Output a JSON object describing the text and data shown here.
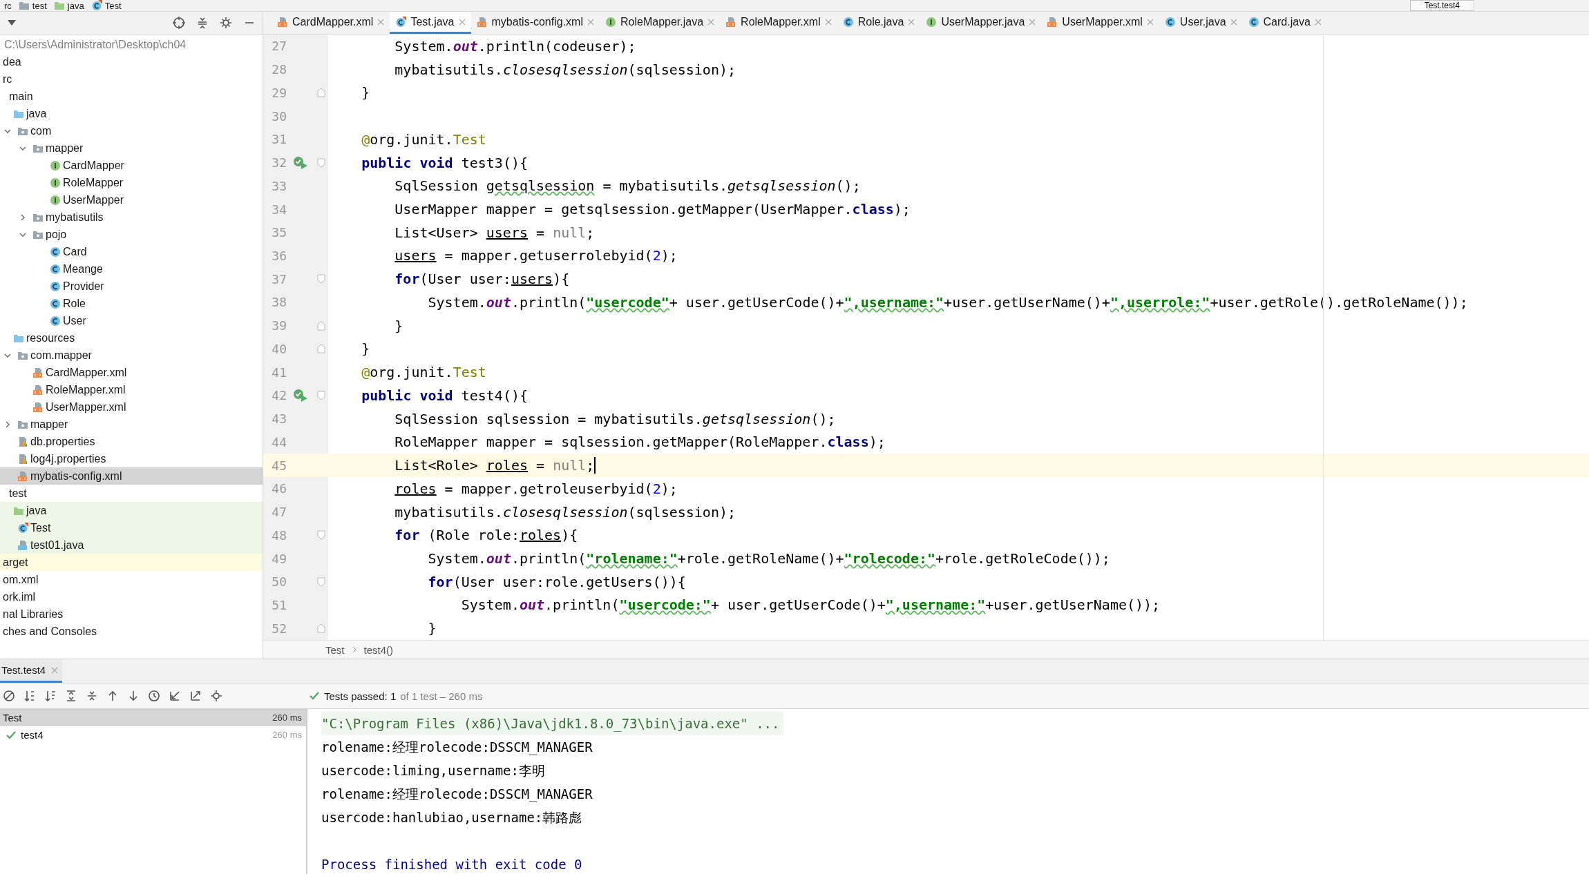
{
  "nav_bar": {
    "crumbs": [
      {
        "label": "rc",
        "kind": "none"
      },
      {
        "label": "test",
        "kind": "folder"
      },
      {
        "label": "java",
        "kind": "test-folder"
      },
      {
        "label": "Test",
        "kind": "test-class"
      }
    ],
    "run_config": "Test.test4"
  },
  "project": {
    "path": "C:\\Users\\Administrator\\Desktop\\ch04",
    "tree": [
      {
        "label": "dea",
        "selected": false
      },
      {
        "label": "rc",
        "selected": false,
        "children": [
          {
            "label": "main",
            "selected": false,
            "children": [
              {
                "label": "java",
                "kind": "source-folder",
                "selected": false,
                "children": [
                  {
                    "label": "com",
                    "kind": "package",
                    "expanded": true,
                    "selected": false,
                    "children": [
                      {
                        "label": "mapper",
                        "kind": "package",
                        "expanded": true,
                        "selected": false,
                        "children": [
                          {
                            "label": "CardMapper",
                            "kind": "interface",
                            "selected": false
                          },
                          {
                            "label": "RoleMapper",
                            "kind": "interface",
                            "selected": false
                          },
                          {
                            "label": "UserMapper",
                            "kind": "interface",
                            "selected": false
                          }
                        ]
                      },
                      {
                        "label": "mybatisutils",
                        "kind": "package",
                        "expanded": false,
                        "selected": false
                      },
                      {
                        "label": "pojo",
                        "kind": "package",
                        "expanded": true,
                        "selected": false,
                        "children": [
                          {
                            "label": "Card",
                            "kind": "class",
                            "selected": false
                          },
                          {
                            "label": "Meange",
                            "kind": "class",
                            "selected": false
                          },
                          {
                            "label": "Provider",
                            "kind": "class",
                            "selected": false
                          },
                          {
                            "label": "Role",
                            "kind": "class",
                            "selected": false
                          },
                          {
                            "label": "User",
                            "kind": "class",
                            "selected": false
                          }
                        ]
                      }
                    ]
                  }
                ]
              },
              {
                "label": "resources",
                "kind": "resource-folder",
                "selected": false,
                "children": [
                  {
                    "label": "com.mapper",
                    "kind": "package",
                    "expanded": true,
                    "selected": false,
                    "children": [
                      {
                        "label": "CardMapper.xml",
                        "kind": "xml",
                        "selected": false
                      },
                      {
                        "label": "RoleMapper.xml",
                        "kind": "xml",
                        "selected": false
                      },
                      {
                        "label": "UserMapper.xml",
                        "kind": "xml",
                        "selected": false
                      }
                    ]
                  },
                  {
                    "label": "mapper",
                    "kind": "package",
                    "expanded": false,
                    "selected": false
                  },
                  {
                    "label": "db.properties",
                    "kind": "properties",
                    "selected": false
                  },
                  {
                    "label": "log4j.properties",
                    "kind": "properties",
                    "selected": false
                  },
                  {
                    "label": "mybatis-config.xml",
                    "kind": "xml",
                    "selected": true
                  }
                ]
              }
            ]
          },
          {
            "label": "test",
            "selected": false,
            "children": [
              {
                "label": "java",
                "kind": "test-folder",
                "test_source": true,
                "selected": false,
                "children": [
                  {
                    "label": "Test",
                    "kind": "test-class",
                    "test_source": true,
                    "selected": false
                  },
                  {
                    "label": "test01.java",
                    "kind": "java-file",
                    "test_source": true,
                    "selected": false
                  }
                ]
              }
            ]
          }
        ]
      },
      {
        "label": "arget",
        "excluded": true,
        "selected": false
      },
      {
        "label": "om.xml",
        "selected": false
      },
      {
        "label": "ork.iml",
        "selected": false
      },
      {
        "label": "nal Libraries",
        "selected": false
      },
      {
        "label": "ches and Consoles",
        "selected": false
      }
    ]
  },
  "tabs": [
    {
      "label": "CardMapper.xml",
      "kind": "xml",
      "selected": false
    },
    {
      "label": "Test.java",
      "kind": "test-class",
      "selected": true
    },
    {
      "label": "mybatis-config.xml",
      "kind": "xml",
      "selected": false
    },
    {
      "label": "RoleMapper.java",
      "kind": "interface",
      "selected": false
    },
    {
      "label": "RoleMapper.xml",
      "kind": "xml",
      "selected": false
    },
    {
      "label": "Role.java",
      "kind": "class",
      "selected": false
    },
    {
      "label": "UserMapper.java",
      "kind": "interface",
      "selected": false
    },
    {
      "label": "UserMapper.xml",
      "kind": "xml",
      "selected": false
    },
    {
      "label": "User.java",
      "kind": "class",
      "selected": false
    },
    {
      "label": "Card.java",
      "kind": "class",
      "selected": false
    }
  ],
  "editor": {
    "lines": [
      {
        "number": "27",
        "current": false,
        "tokens": [
          {
            "kind": "plain",
            "text": "        System."
          },
          {
            "kind": "field",
            "text": "out"
          },
          {
            "kind": "plain",
            "text": ".println(codeuser);"
          }
        ]
      },
      {
        "number": "28",
        "current": false,
        "tokens": [
          {
            "kind": "plain",
            "text": "        mybatisutils."
          },
          {
            "kind": "static",
            "text": "closesqlsession"
          },
          {
            "kind": "plain",
            "text": "(sqlsession);"
          }
        ]
      },
      {
        "number": "29",
        "current": false,
        "fold_end": true,
        "tokens": [
          {
            "kind": "plain",
            "text": "    }"
          }
        ]
      },
      {
        "number": "30",
        "current": false
      },
      {
        "number": "31",
        "current": false,
        "tokens": [
          {
            "kind": "annotation",
            "text": "    @"
          },
          {
            "kind": "plain",
            "text": "org.junit."
          },
          {
            "kind": "annotation",
            "text": "Test"
          }
        ]
      },
      {
        "number": "32",
        "current": false,
        "run": true,
        "fold_start": true,
        "tokens": [
          {
            "kind": "keyword",
            "text": "    public void"
          },
          {
            "kind": "plain",
            "text": " test3(){"
          }
        ]
      },
      {
        "number": "33",
        "current": false,
        "tokens": [
          {
            "kind": "plain",
            "text": "        SqlSession "
          },
          {
            "kind": "typo",
            "text": "getsqlsession"
          },
          {
            "kind": "plain",
            "text": " = mybatisutils."
          },
          {
            "kind": "static",
            "text": "getsqlsession"
          },
          {
            "kind": "plain",
            "text": "();"
          }
        ]
      },
      {
        "number": "34",
        "current": false,
        "tokens": [
          {
            "kind": "plain",
            "text": "        UserMapper mapper = getsqlsession.getMapper(UserMapper."
          },
          {
            "kind": "keyword",
            "text": "class"
          },
          {
            "kind": "plain",
            "text": ");"
          }
        ]
      },
      {
        "number": "35",
        "current": false,
        "tokens": [
          {
            "kind": "plain",
            "text": "        List<User> "
          },
          {
            "kind": "reassigned",
            "text": "users"
          },
          {
            "kind": "plain",
            "text": " = "
          },
          {
            "kind": "null",
            "text": "null"
          },
          {
            "kind": "plain",
            "text": ";"
          }
        ]
      },
      {
        "number": "36",
        "current": false,
        "tokens": [
          {
            "kind": "reassigned",
            "text": "        users"
          },
          {
            "kind": "plain",
            "text": " = mapper.getuserrolebyid("
          },
          {
            "kind": "number",
            "text": "2"
          },
          {
            "kind": "plain",
            "text": ");"
          }
        ]
      },
      {
        "number": "37",
        "current": false,
        "fold_start": true,
        "tokens": [
          {
            "kind": "keyword",
            "text": "        for"
          },
          {
            "kind": "plain",
            "text": "(User user:"
          },
          {
            "kind": "reassigned",
            "text": "users"
          },
          {
            "kind": "plain",
            "text": "){"
          }
        ]
      },
      {
        "number": "38",
        "current": false,
        "tokens": [
          {
            "kind": "plain",
            "text": "            System."
          },
          {
            "kind": "field",
            "text": "out"
          },
          {
            "kind": "plain",
            "text": ".println("
          },
          {
            "kind": "string",
            "text": "\"usercode\""
          },
          {
            "kind": "plain",
            "text": "+ user.getUserCode()+"
          },
          {
            "kind": "string",
            "text": "\",username:\""
          },
          {
            "kind": "plain",
            "text": "+user.getUserName()+"
          },
          {
            "kind": "string",
            "text": "\",userrole:\""
          },
          {
            "kind": "plain",
            "text": "+user.getRole().getRoleName());"
          }
        ]
      },
      {
        "number": "39",
        "current": false,
        "fold_end": true,
        "tokens": [
          {
            "kind": "plain",
            "text": "        }"
          }
        ]
      },
      {
        "number": "40",
        "current": false,
        "fold_end": true,
        "tokens": [
          {
            "kind": "plain",
            "text": "    }"
          }
        ]
      },
      {
        "number": "41",
        "current": false,
        "tokens": [
          {
            "kind": "annotation",
            "text": "    @"
          },
          {
            "kind": "plain",
            "text": "org.junit."
          },
          {
            "kind": "annotation",
            "text": "Test"
          }
        ]
      },
      {
        "number": "42",
        "current": false,
        "run": true,
        "fold_start": true,
        "tokens": [
          {
            "kind": "keyword",
            "text": "    public void"
          },
          {
            "kind": "plain",
            "text": " test4(){"
          }
        ]
      },
      {
        "number": "43",
        "current": false,
        "tokens": [
          {
            "kind": "plain",
            "text": "        SqlSession sqlsession = mybatisutils."
          },
          {
            "kind": "static",
            "text": "getsqlsession"
          },
          {
            "kind": "plain",
            "text": "();"
          }
        ]
      },
      {
        "number": "44",
        "current": false,
        "tokens": [
          {
            "kind": "plain",
            "text": "        RoleMapper mapper = sqlsession.getMapper(RoleMapper."
          },
          {
            "kind": "keyword",
            "text": "class"
          },
          {
            "kind": "plain",
            "text": ");"
          }
        ]
      },
      {
        "number": "45",
        "current": true,
        "tokens": [
          {
            "kind": "plain",
            "text": "        List<Role> "
          },
          {
            "kind": "reassigned",
            "text": "roles"
          },
          {
            "kind": "plain",
            "text": " = "
          },
          {
            "kind": "null",
            "text": "null"
          },
          {
            "kind": "plain",
            "text": ";"
          }
        ]
      },
      {
        "number": "46",
        "current": false,
        "tokens": [
          {
            "kind": "reassigned",
            "text": "        roles"
          },
          {
            "kind": "plain",
            "text": " = mapper.getroleuserbyid("
          },
          {
            "kind": "number",
            "text": "2"
          },
          {
            "kind": "plain",
            "text": ");"
          }
        ]
      },
      {
        "number": "47",
        "current": false,
        "tokens": [
          {
            "kind": "plain",
            "text": "        mybatisutils."
          },
          {
            "kind": "static",
            "text": "closesqlsession"
          },
          {
            "kind": "plain",
            "text": "(sqlsession);"
          }
        ]
      },
      {
        "number": "48",
        "current": false,
        "fold_start": true,
        "tokens": [
          {
            "kind": "keyword",
            "text": "        for"
          },
          {
            "kind": "plain",
            "text": " (Role role:"
          },
          {
            "kind": "reassigned",
            "text": "roles"
          },
          {
            "kind": "plain",
            "text": "){"
          }
        ]
      },
      {
        "number": "49",
        "current": false,
        "tokens": [
          {
            "kind": "plain",
            "text": "            System."
          },
          {
            "kind": "field",
            "text": "out"
          },
          {
            "kind": "plain",
            "text": ".println("
          },
          {
            "kind": "string",
            "text": "\"rolename:\""
          },
          {
            "kind": "plain",
            "text": "+role.getRoleName()+"
          },
          {
            "kind": "string",
            "text": "\"rolecode:\""
          },
          {
            "kind": "plain",
            "text": "+role.getRoleCode());"
          }
        ]
      },
      {
        "number": "50",
        "current": false,
        "fold_start": true,
        "tokens": [
          {
            "kind": "keyword",
            "text": "            for"
          },
          {
            "kind": "plain",
            "text": "(User user:role.getUsers()){"
          }
        ]
      },
      {
        "number": "51",
        "current": false,
        "tokens": [
          {
            "kind": "plain",
            "text": "                System."
          },
          {
            "kind": "field",
            "text": "out"
          },
          {
            "kind": "plain",
            "text": ".println("
          },
          {
            "kind": "string",
            "text": "\"usercode:\""
          },
          {
            "kind": "plain",
            "text": "+ user.getUserCode()+"
          },
          {
            "kind": "string",
            "text": "\",username:\""
          },
          {
            "kind": "plain",
            "text": "+user.getUserName());"
          }
        ]
      },
      {
        "number": "52",
        "current": false,
        "fold_end": true,
        "tokens": [
          {
            "kind": "plain",
            "text": "            }"
          }
        ]
      }
    ],
    "breadcrumbs": [
      "Test",
      "test4()"
    ]
  },
  "run_panel": {
    "tab": "Test.test4",
    "status": {
      "passed": "Tests passed: 1",
      "detail": "of 1 test – 260 ms"
    },
    "tests": [
      {
        "name": "Test",
        "time": "260 ms",
        "selected": true,
        "passed": false
      },
      {
        "name": "test4",
        "time": "260 ms",
        "selected": false,
        "passed": true
      }
    ],
    "console": [
      {
        "kind": "command",
        "text": "\"C:\\Program Files (x86)\\Java\\jdk1.8.0_73\\bin\\java.exe\" ..."
      },
      {
        "kind": "output",
        "text": "rolename:经理rolecode:DSSCM_MANAGER"
      },
      {
        "kind": "output",
        "text": "usercode:liming,username:李明"
      },
      {
        "kind": "output",
        "text": "rolename:经理rolecode:DSSCM_MANAGER"
      },
      {
        "kind": "output",
        "text": "usercode:hanlubiao,username:韩路彪"
      },
      {
        "kind": "exit",
        "text": "Process finished with exit code 0"
      }
    ]
  }
}
